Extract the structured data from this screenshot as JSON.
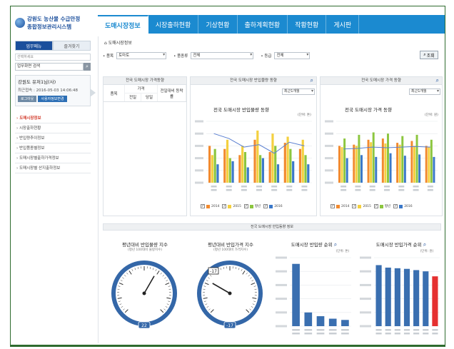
{
  "header": {
    "logo_line1": "강원도 농산물 수급안정",
    "logo_line2": "종합정보관리시스템",
    "nav": [
      "도매시장정보",
      "시장출하현황",
      "기상현황",
      "출하계획현황",
      "작황현황",
      "게시판"
    ]
  },
  "left": {
    "tabs": [
      "업무메뉴",
      "즐겨찾기"
    ],
    "select_placeholder": "선택하세요",
    "search_value": "업무화면 검색",
    "user_name": "강원도 유저1님(사)",
    "login_time": "최근접속 : 2016-05-03 14:06:48",
    "btn_logout": "로그아웃",
    "btn_mypage": "사용자정보변경",
    "menu": [
      "도매시장정보",
      "시장출하현황",
      "반입량추이정보",
      "반입품종별정보",
      "도매시장별출하가격정보",
      "도매시장별 산지출하정보"
    ]
  },
  "main": {
    "breadcrumb": "도매시장정보",
    "filters": {
      "label_item": "품목",
      "value_item": "토마토",
      "label_kind": "품종류",
      "value_kind": "전체",
      "label_grade": "등급",
      "value_grade": "전체",
      "search_btn": "조회"
    },
    "table_panel": {
      "head": "전국 도매시장 가격동향",
      "col_item": "품목",
      "col_price": "가격",
      "col_week": "전일",
      "col_today": "당일",
      "col_ratio": "전일대비 등락률"
    },
    "vol_panel": {
      "head": "전국 도매시장 반입물량 동향",
      "select": "최근1개월",
      "title": "전국 도매시장 반입물량 동향",
      "unit": "(단위: 톤)"
    },
    "price_panel": {
      "head": "전국 도매시장 가격 동향",
      "select": "최근1개월",
      "title": "전국 도매시장 가격 동향",
      "unit": "(단위: 원)"
    },
    "section_title": "전국 도매시장 반입동향 정보",
    "gauge1": {
      "title": "평년대비 반입물량 지수",
      "sub": "(평년 100대비 물량지수)",
      "value": "22"
    },
    "gauge2": {
      "title": "평년대비 반입가격 지수",
      "sub": "(평년 100대비 가격지수)",
      "value": "-17",
      "marker": "-17"
    },
    "rank1": {
      "title": "도매시장 반입량 순위",
      "unit": "(단위: 톤)"
    },
    "rank2": {
      "title": "도매시장 반입가격 순위",
      "unit": "(단위: 원)"
    }
  },
  "colors": {
    "nav_bg": "#1b8ad0",
    "orange": "#f28a2e",
    "yellow": "#f4d03f",
    "green": "#8cc63f",
    "blue": "#3a78c9",
    "gauge_blue": "#3467a8",
    "rank_blue": "#3a6fb0",
    "rank_red": "#e53030"
  },
  "chart_data": [
    {
      "type": "bar",
      "title": "전국 도매시장 반입물량 동향",
      "categories": [
        "c1",
        "c2",
        "c3",
        "c4",
        "c5",
        "c6",
        "c7"
      ],
      "series": [
        {
          "values": [
            60,
            55,
            45,
            70,
            50,
            65,
            55
          ]
        },
        {
          "values": [
            45,
            70,
            60,
            85,
            80,
            75,
            70
          ]
        },
        {
          "values": [
            55,
            40,
            50,
            45,
            60,
            55,
            45
          ]
        },
        {
          "values": [
            30,
            35,
            25,
            40,
            30,
            35,
            30
          ]
        }
      ],
      "line": [
        80,
        72,
        58,
        62,
        48,
        66,
        60
      ],
      "ylim": [
        0,
        100
      ],
      "legend": "bottom"
    },
    {
      "type": "bar",
      "title": "전국 도매시장 가격 동향",
      "categories": [
        "c1",
        "c2",
        "c3",
        "c4",
        "c5",
        "c6",
        "c7"
      ],
      "series": [
        {
          "values": [
            60,
            62,
            70,
            72,
            65,
            68,
            60
          ]
        },
        {
          "values": [
            58,
            60,
            66,
            64,
            62,
            60,
            58
          ]
        },
        {
          "values": [
            72,
            78,
            82,
            80,
            76,
            78,
            70
          ]
        },
        {
          "values": [
            40,
            45,
            42,
            48,
            44,
            46,
            42
          ]
        }
      ],
      "line": [
        55,
        56,
        58,
        57,
        58,
        59,
        58
      ],
      "ylim": [
        0,
        100
      ],
      "legend": "bottom"
    },
    {
      "type": "bar",
      "title": "도매시장 반입량 순위",
      "categories": [
        "r1",
        "r2",
        "r3",
        "r4",
        "r5"
      ],
      "values": [
        100,
        22,
        16,
        12,
        10
      ],
      "ylim": [
        0,
        110
      ]
    },
    {
      "type": "bar",
      "title": "도매시장 반입가격 순위",
      "categories": [
        "r1",
        "r2",
        "r3",
        "r4",
        "r5",
        "r6",
        "r7"
      ],
      "values": [
        98,
        94,
        93,
        92,
        90,
        88,
        80
      ],
      "highlight_last": true,
      "ylim": [
        0,
        110
      ]
    }
  ]
}
